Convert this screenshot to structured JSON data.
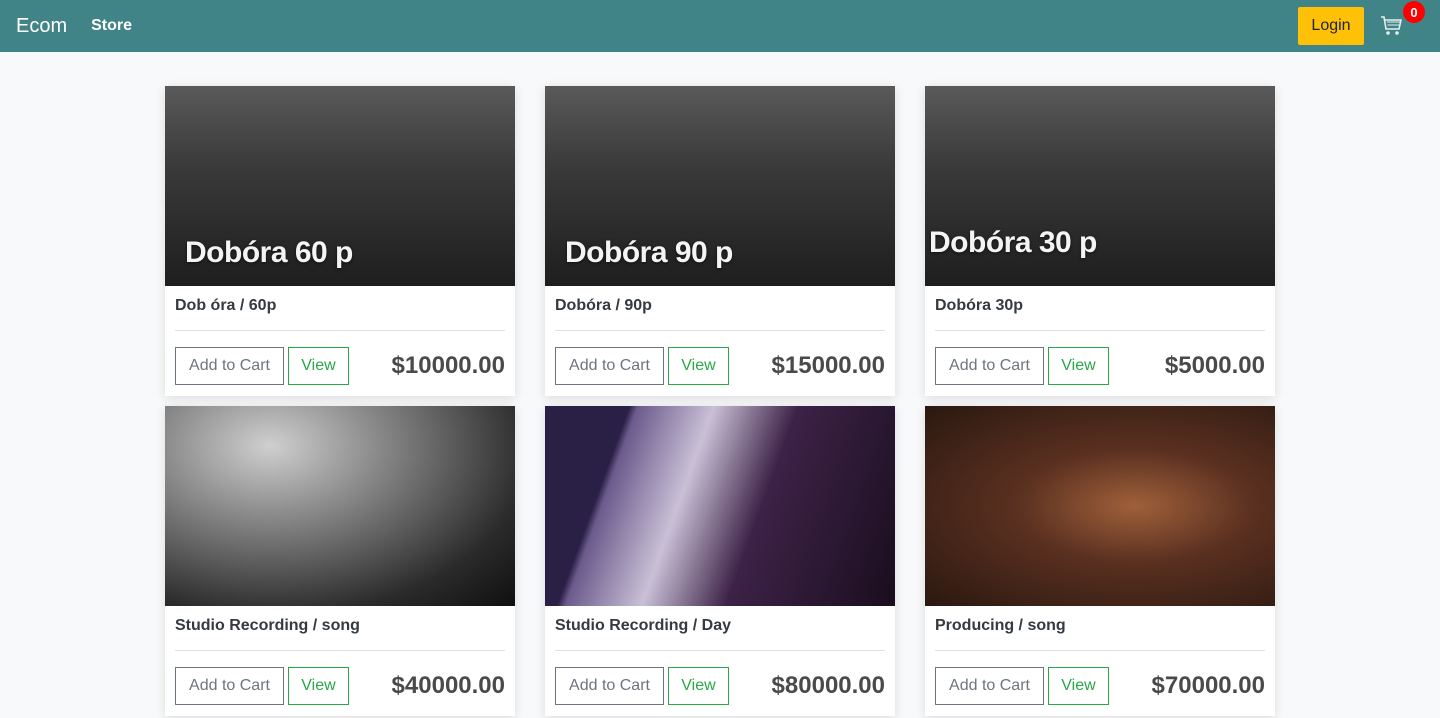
{
  "navbar": {
    "brand": "Ecom",
    "store_link": "Store",
    "login_label": "Login",
    "cart_count": "0"
  },
  "colors": {
    "navbar": "#418488",
    "login": "#ffc107",
    "badge": "#ff0000",
    "view": "#28a745"
  },
  "products": [
    {
      "title": "Dob óra / 60p",
      "overlay": "Dobóra 60 p",
      "price": "$10000.00",
      "add_label": "Add to Cart",
      "view_label": "View"
    },
    {
      "title": "Dobóra / 90p",
      "overlay": "Dobóra 90 p",
      "price": "$15000.00",
      "add_label": "Add to Cart",
      "view_label": "View"
    },
    {
      "title": "Dobóra 30p",
      "overlay": "Dobóra 30 p",
      "price": "$5000.00",
      "add_label": "Add to Cart",
      "view_label": "View"
    },
    {
      "title": "Studio Recording / song",
      "overlay": "",
      "price": "$40000.00",
      "add_label": "Add to Cart",
      "view_label": "View"
    },
    {
      "title": "Studio Recording / Day",
      "overlay": "",
      "price": "$80000.00",
      "add_label": "Add to Cart",
      "view_label": "View"
    },
    {
      "title": "Producing / song",
      "overlay": "",
      "price": "$70000.00",
      "add_label": "Add to Cart",
      "view_label": "View"
    }
  ]
}
